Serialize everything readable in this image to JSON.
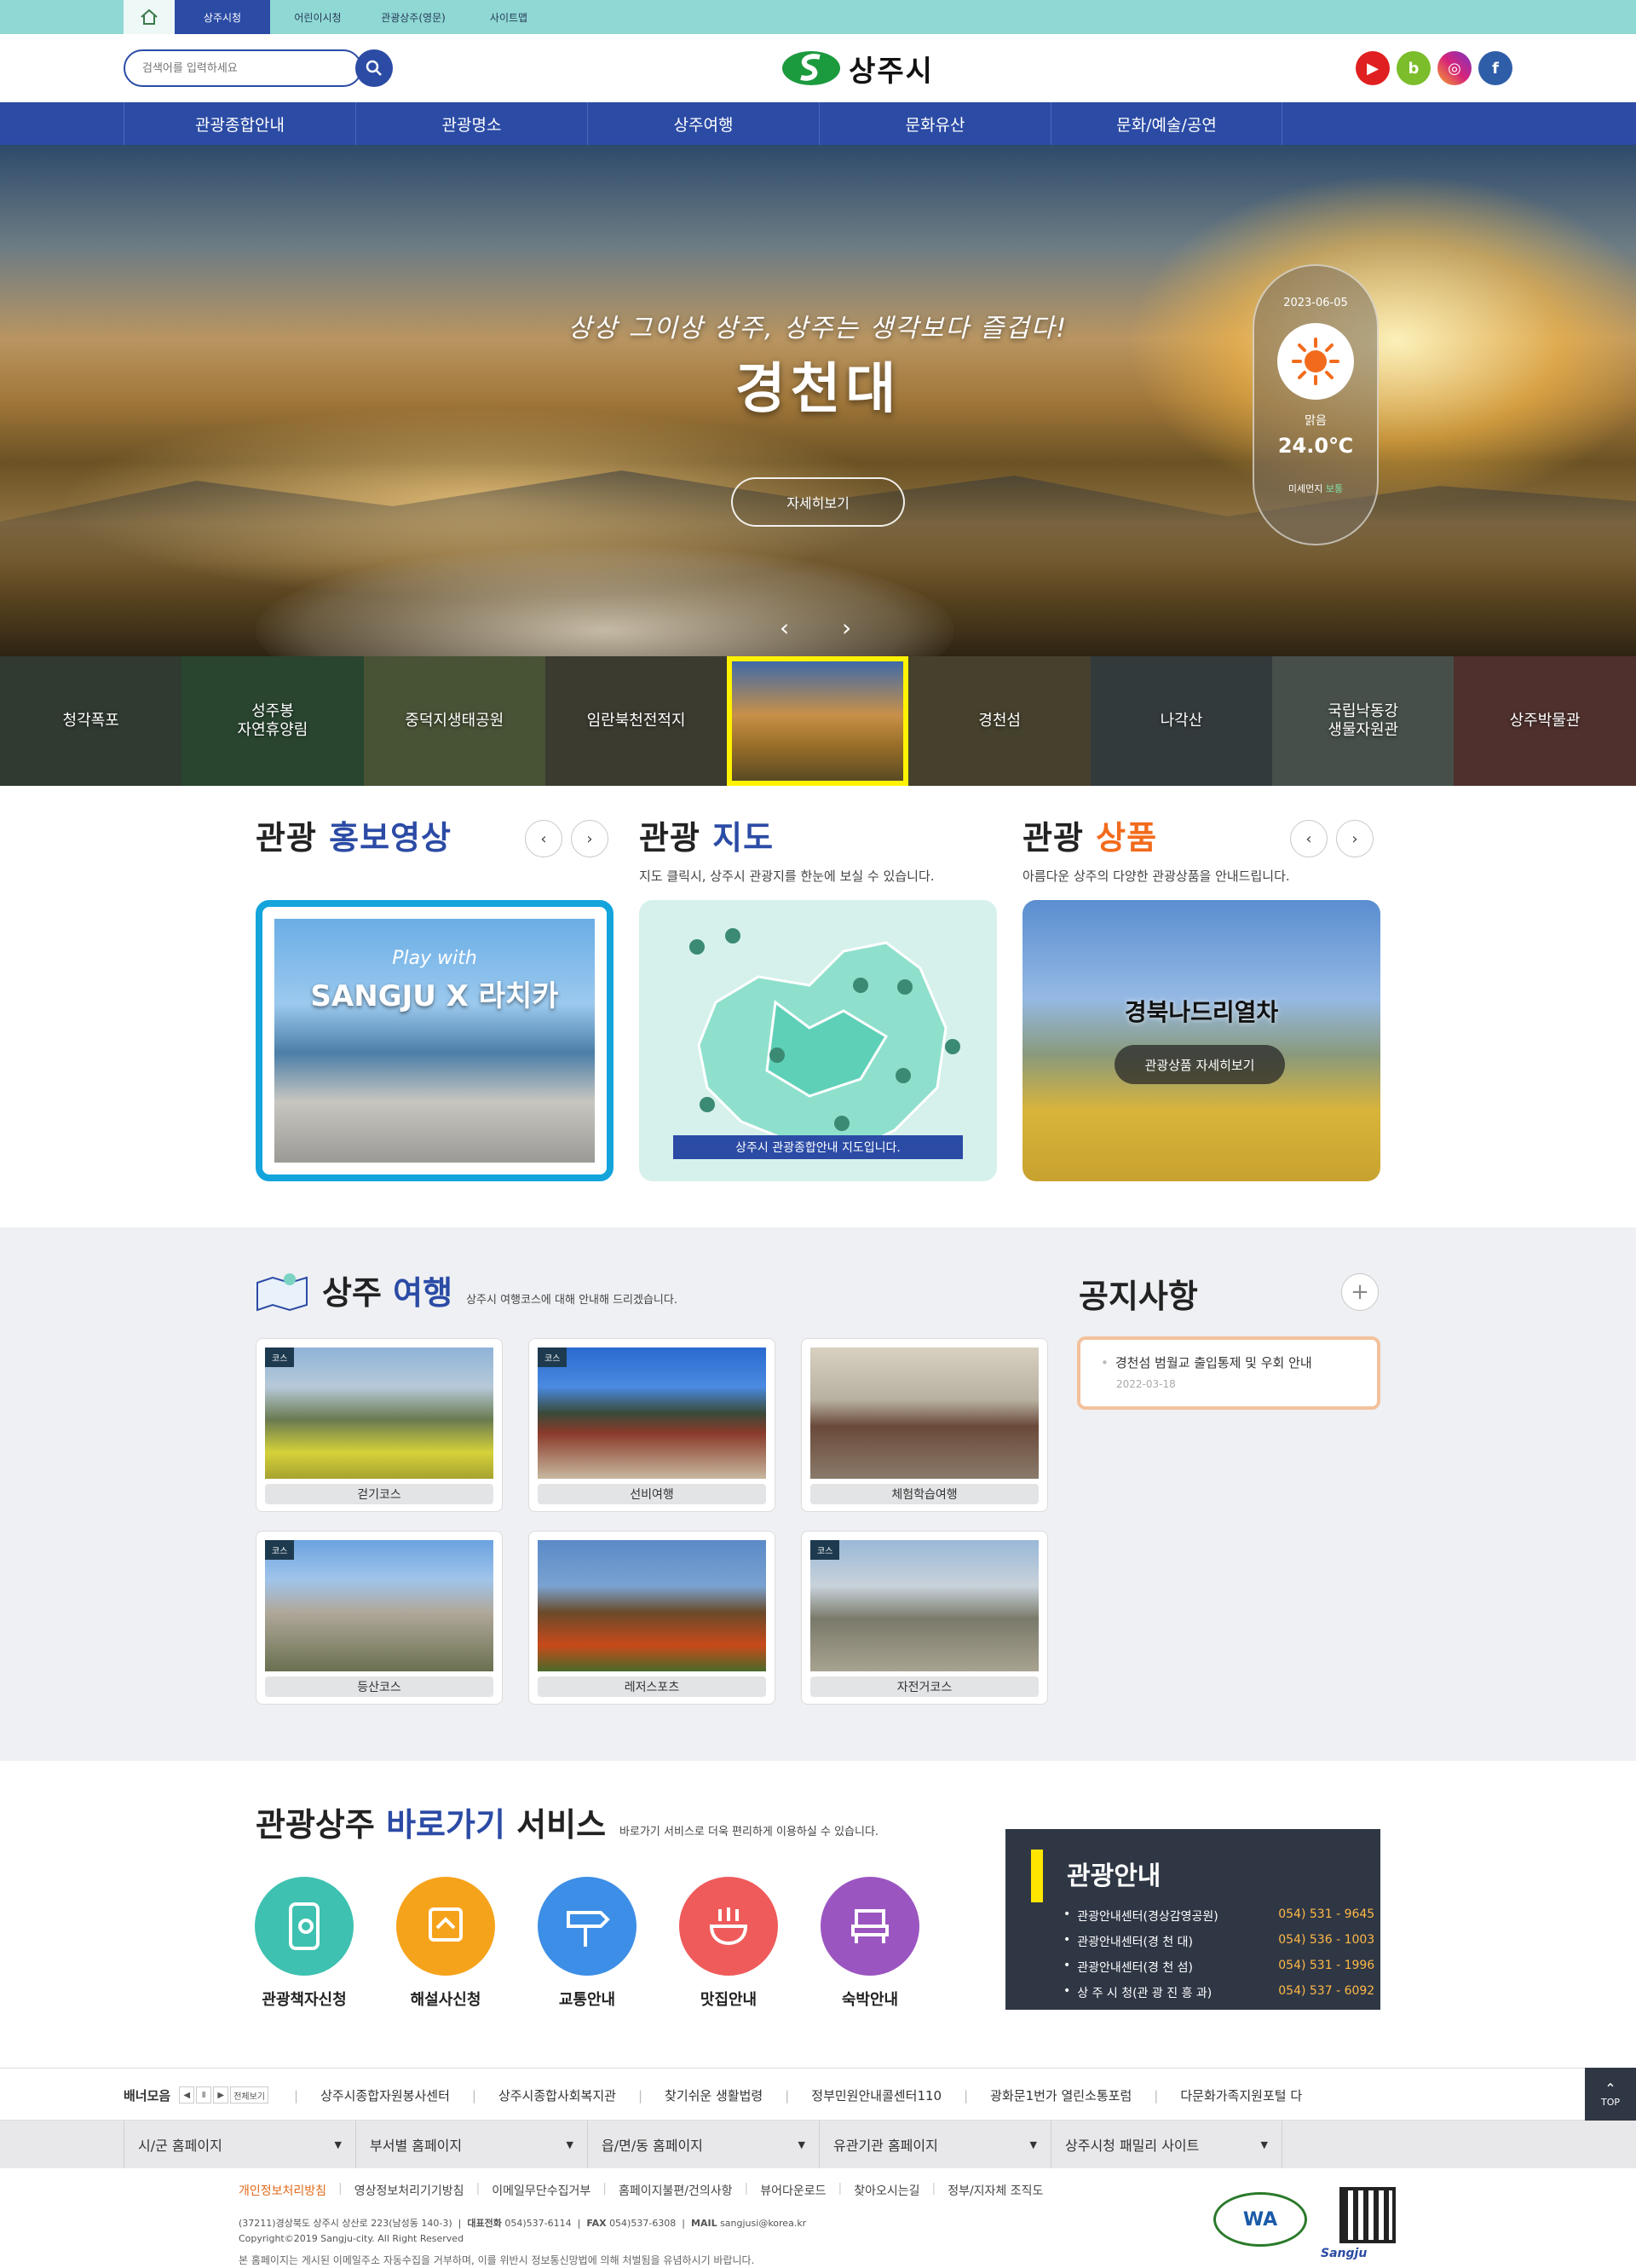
{
  "top_tabs": [
    "상주시청",
    "어린이시청",
    "관광상주(영문)",
    "사이트맵"
  ],
  "search": {
    "placeholder": "검색어를 입력하세요"
  },
  "logo_text": "상주시",
  "sns": [
    "youtube-icon",
    "blog-icon",
    "instagram-icon",
    "facebook-icon"
  ],
  "gnb": [
    "관광종합안내",
    "관광명소",
    "상주여행",
    "문화유산",
    "문화/예술/공연"
  ],
  "hero": {
    "subtitle": "상상 그이상 상주, 상주는 생각보다 즐겁다!",
    "title": "경천대",
    "more": "자세히보기"
  },
  "weather": {
    "date": "2023-06-05",
    "condition": "맑음",
    "temp": "24.0℃",
    "dust_label": "미세먼지",
    "dust_value": "보통"
  },
  "thumbs": [
    "청각폭포",
    "성주봉\n자연휴양림",
    "중덕지생태공원",
    "임란북천전적지",
    "",
    "경천섬",
    "나각산",
    "국립낙동강\n생물자원관",
    "상주박물관"
  ],
  "video": {
    "title_a": "관광",
    "title_b": "홍보영상",
    "play_text": "Play with",
    "big": "SANGJU X 라치카"
  },
  "map": {
    "title_a": "관광",
    "title_b": "지도",
    "desc": "지도 클릭시, 상주시 관광지를 한눈에 보실 수 있습니다.",
    "caption": "상주시 관광종합안내 지도입니다."
  },
  "product": {
    "title_a": "관광",
    "title_b": "상품",
    "desc": "아름다운 상주의 다양한 관광상품을 안내드립니다.",
    "name": "경북나드리열차",
    "button": "관광상품 자세히보기"
  },
  "travel": {
    "title_a": "상주",
    "title_b": "여행",
    "desc": "상주시 여행코스에 대해 안내해 드리겠습니다.",
    "tag": "코스",
    "courses": [
      "걷기코스",
      "선비여행",
      "체험학습여행",
      "등산코스",
      "레저스포츠",
      "자전거코스"
    ]
  },
  "notice": {
    "title": "공지사항",
    "item": "경천섬 범월교 출입통제 및 우회 안내",
    "date": "2022-03-18"
  },
  "quick": {
    "title_a": "관광상주",
    "title_b": "바로가기",
    "title_c": "서비스",
    "desc": "바로가기 서비스로 더욱 편리하게 이용하실 수 있습니다.",
    "items": [
      "관광책자신청",
      "해설사신청",
      "교통안내",
      "맛집안내",
      "숙박안내"
    ]
  },
  "tour_info": {
    "title": "관광안내",
    "rows": [
      {
        "name": "관광안내센터(경상감영공원)",
        "phone": "054) 531 - 9645"
      },
      {
        "name": "관광안내센터(경  천  대)",
        "phone": "054) 536 - 1003"
      },
      {
        "name": "관광안내센터(경  천  섬)",
        "phone": "054) 531 - 1996"
      },
      {
        "name": "상 주 시 청(관 광 진 흥 과)",
        "phone": "054) 537 - 6092"
      }
    ]
  },
  "banners": {
    "label": "배너모음",
    "ctl": [
      "◀",
      "Ⅱ",
      "▶",
      "전체보기"
    ],
    "links": [
      "상주시종합자원봉사센터",
      "상주시종합사회복지관",
      "찾기쉬운 생활법령",
      "정부민원안내콜센터110",
      "광화문1번가 열린소통포럼",
      "다문화가족지원포털 다"
    ]
  },
  "top_button": "TOP",
  "family": [
    "시/군 홈페이지",
    "부서별 홈페이지",
    "읍/면/동 홈페이지",
    "유관기관 홈페이지",
    "상주시청 패밀리 사이트"
  ],
  "footer": {
    "links": [
      "개인정보처리방침",
      "영상정보처리기기방침",
      "이메일무단수집거부",
      "홈페이지불편/건의사항",
      "뷰어다운로드",
      "찾아오시는길",
      "정부/지자체 조직도"
    ],
    "address": "(37211)경상북도 상주시 상산로 223(남성동 140-3)",
    "tel_label": "대표전화",
    "tel": "054)537-6114",
    "fax_label": "FAX",
    "fax": "054)537-6308",
    "mail_label": "MAIL",
    "mail": "sangjusi@korea.kr",
    "copyright": "Copyright©2019 Sangju-city. All Right Reserved",
    "warning": "본 홈페이지는 게시된 이메일주소 자동수집을 거부하며, 이를 위반시 정보통신망법에 의해 처벌됨을 유념하시기 바랍니다.",
    "wa_text": "WA",
    "qr_label": "Sangju"
  }
}
